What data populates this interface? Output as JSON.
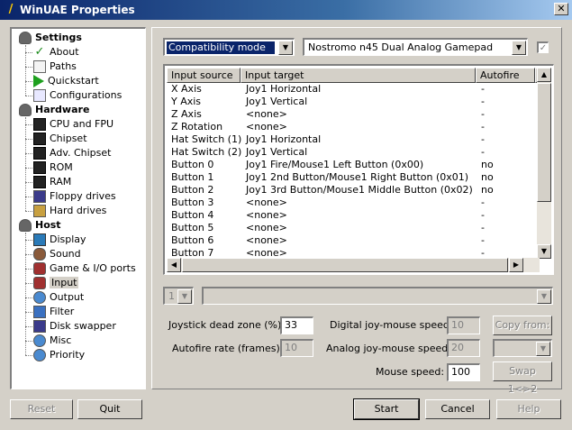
{
  "window": {
    "title": "WinUAE Properties",
    "close_glyph": "✕",
    "app_icon": "wand-icon"
  },
  "tree": {
    "items": [
      {
        "label": "Settings",
        "icon": "disk-icon",
        "level": 0,
        "bold": true
      },
      {
        "label": "About",
        "icon": "check-icon",
        "level": 1
      },
      {
        "label": "Paths",
        "icon": "doc-icon",
        "level": 1
      },
      {
        "label": "Quickstart",
        "icon": "play-icon",
        "level": 1
      },
      {
        "label": "Configurations",
        "icon": "config-icon",
        "level": 1
      },
      {
        "label": "Hardware",
        "icon": "disk-icon",
        "level": 0,
        "bold": true
      },
      {
        "label": "CPU and FPU",
        "icon": "chip-icon",
        "level": 1
      },
      {
        "label": "Chipset",
        "icon": "chip-icon",
        "level": 1
      },
      {
        "label": "Adv. Chipset",
        "icon": "chip-icon",
        "level": 1
      },
      {
        "label": "ROM",
        "icon": "chip-icon",
        "level": 1
      },
      {
        "label": "RAM",
        "icon": "chip-icon",
        "level": 1
      },
      {
        "label": "Floppy drives",
        "icon": "floppy-icon",
        "level": 1
      },
      {
        "label": "Hard drives",
        "icon": "harddrive-icon",
        "level": 1
      },
      {
        "label": "Host",
        "icon": "disk-icon",
        "level": 0,
        "bold": true
      },
      {
        "label": "Display",
        "icon": "monitor-icon",
        "level": 1
      },
      {
        "label": "Sound",
        "icon": "sound-icon",
        "level": 1
      },
      {
        "label": "Game & I/O ports",
        "icon": "joystick-icon",
        "level": 1
      },
      {
        "label": "Input",
        "icon": "joystick-icon",
        "level": 1,
        "selected": true
      },
      {
        "label": "Output",
        "icon": "people-icon",
        "level": 1
      },
      {
        "label": "Filter",
        "icon": "filter-icon",
        "level": 1
      },
      {
        "label": "Disk swapper",
        "icon": "floppy-icon",
        "level": 1
      },
      {
        "label": "Misc",
        "icon": "people-icon",
        "level": 1
      },
      {
        "label": "Priority",
        "icon": "people-icon",
        "level": 1
      }
    ]
  },
  "input": {
    "mode": "Compatibility mode",
    "device": "Nostromo n45 Dual Analog Gamepad",
    "columns": [
      "Input source",
      "Input target",
      "Autofire",
      ""
    ],
    "rows": [
      [
        "X Axis",
        "Joy1 Horizontal",
        "-"
      ],
      [
        "Y Axis",
        "Joy1 Vertical",
        "-"
      ],
      [
        "Z Axis",
        "<none>",
        "-"
      ],
      [
        "Z Rotation",
        "<none>",
        "-"
      ],
      [
        "Hat Switch (1)",
        "Joy1 Horizontal",
        "-"
      ],
      [
        "Hat Switch (2)",
        "Joy1 Vertical",
        "-"
      ],
      [
        "Button 0",
        "Joy1 Fire/Mouse1 Left Button (0x00)",
        "no"
      ],
      [
        "Button 1",
        "Joy1 2nd Button/Mouse1 Right Button (0x01)",
        "no"
      ],
      [
        "Button 2",
        "Joy1 3rd Button/Mouse1 Middle Button (0x02)",
        "no"
      ],
      [
        "Button 3",
        "<none>",
        "-"
      ],
      [
        "Button 4",
        "<none>",
        "-"
      ],
      [
        "Button 5",
        "<none>",
        "-"
      ],
      [
        "Button 6",
        "<none>",
        "-"
      ],
      [
        "Button 7",
        "<none>",
        "-"
      ]
    ],
    "sub_select": "1",
    "dead_zone_label": "Joystick dead zone (%):",
    "dead_zone": "33",
    "autofire_label": "Autofire rate (frames):",
    "autofire": "10",
    "digital_label": "Digital joy-mouse speed:",
    "digital": "10",
    "analog_label": "Analog joy-mouse speed:",
    "analog": "20",
    "mouse_label": "Mouse speed:",
    "mouse": "100",
    "copy_from": "Copy from:",
    "swap": "Swap 1<>2"
  },
  "buttons": {
    "reset": "Reset",
    "quit": "Quit",
    "start": "Start",
    "cancel": "Cancel",
    "help": "Help"
  }
}
